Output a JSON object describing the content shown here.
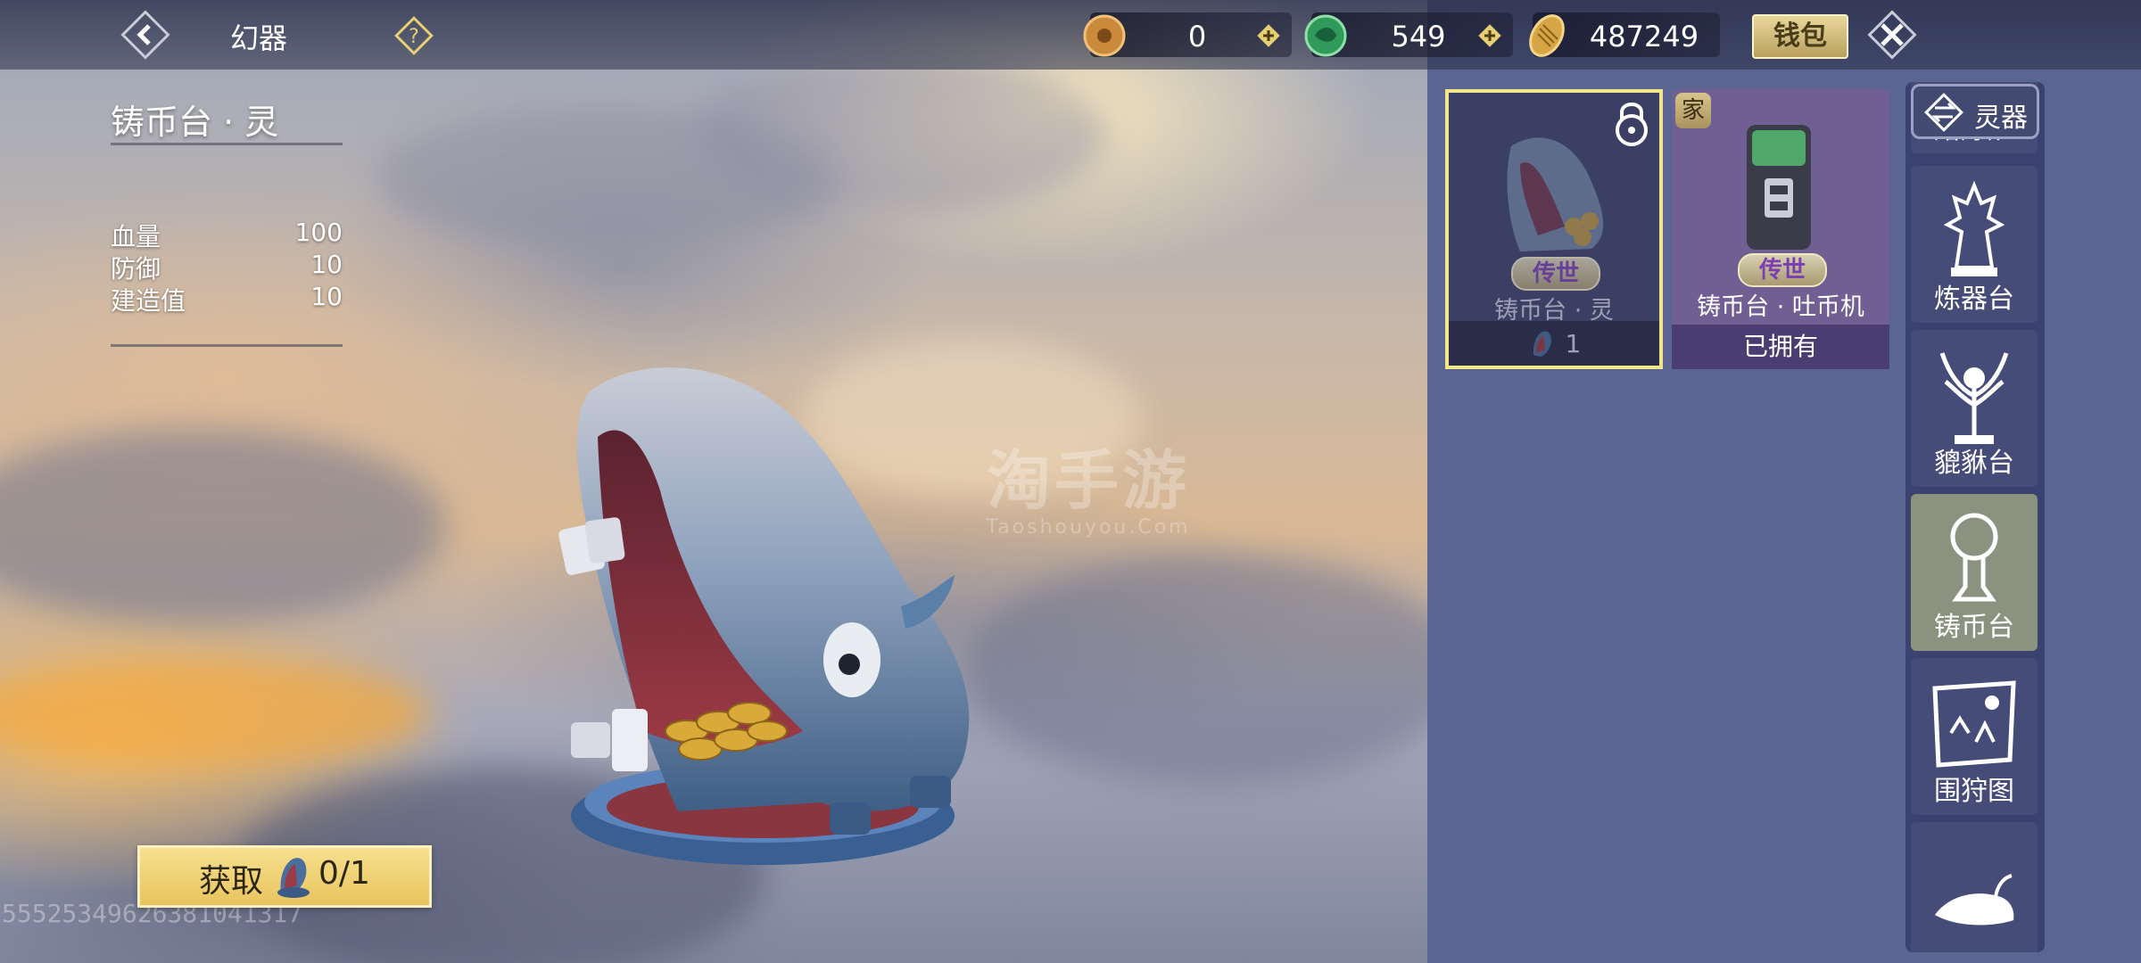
{
  "header": {
    "title": "幻器",
    "back_icon": "chevron-left-icon",
    "help_icon": "question-icon",
    "resources": [
      {
        "name": "bronze-coin",
        "icon": "bronze-coin-icon",
        "value": "0",
        "has_plus": true
      },
      {
        "name": "jade-coin",
        "icon": "jade-coin-icon",
        "value": "549",
        "has_plus": true
      },
      {
        "name": "shell-coin",
        "icon": "shell-coin-icon",
        "value": "487249",
        "has_plus": false
      }
    ],
    "wallet_label": "钱包",
    "close_icon": "close-icon"
  },
  "detail": {
    "name": "铸币台 · 灵",
    "stats": [
      {
        "label": "血量",
        "value": "100"
      },
      {
        "label": "防御",
        "value": "10"
      },
      {
        "label": "建造值",
        "value": "10"
      }
    ],
    "obtain_label": "获取",
    "obtain_count": "0/1"
  },
  "items": [
    {
      "name": "铸币台 · 灵",
      "rarity": "传世",
      "footer": "1",
      "locked": true,
      "selected": true
    },
    {
      "name": "铸币台 · 吐币机",
      "rarity": "传世",
      "footer": "已拥有",
      "home_badge": "家",
      "selected": false
    }
  ],
  "categories": {
    "switch_label": "灵器",
    "tabs": [
      {
        "label": "熔炼炉",
        "icon": "furnace-icon"
      },
      {
        "label": "炼器台",
        "icon": "forge-statue-icon"
      },
      {
        "label": "貔貅台",
        "icon": "pixiu-tree-icon"
      },
      {
        "label": "铸币台",
        "icon": "mint-pedestal-icon",
        "active": true
      },
      {
        "label": "围狩图",
        "icon": "hunting-map-icon"
      },
      {
        "label": "",
        "icon": "creature-icon"
      }
    ]
  },
  "watermark": {
    "text": "淘手游",
    "sub": "Taoshouyou.Com"
  },
  "uid": "5552534962638104131­7"
}
